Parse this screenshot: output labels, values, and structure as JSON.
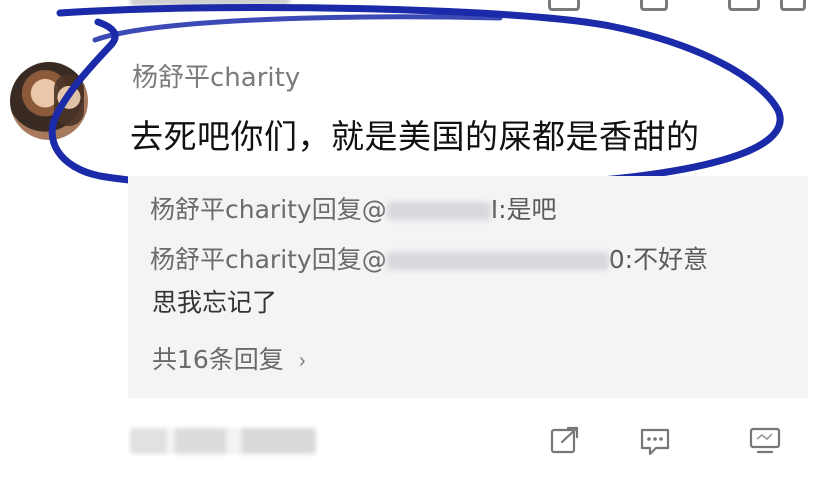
{
  "comment": {
    "username": "杨舒平charity",
    "text": "去死吧你们，就是美国的屎都是香甜的"
  },
  "replies": [
    {
      "author": "杨舒平charity回复@",
      "suffix": "I:是吧"
    },
    {
      "author": "杨舒平charity回复@",
      "suffix": "0:不好意",
      "continuation": "思我忘记了"
    }
  ],
  "more_replies": {
    "label": "共16条回复",
    "chevron": "›"
  },
  "actions": {
    "share_icon": "share-icon",
    "comment_icon": "comment-icon",
    "screen_icon": "screen-icon"
  },
  "colors": {
    "annotation_ink": "#1a2aa8",
    "reply_bg": "#f4f4f6",
    "username": "#7b7b7b"
  }
}
